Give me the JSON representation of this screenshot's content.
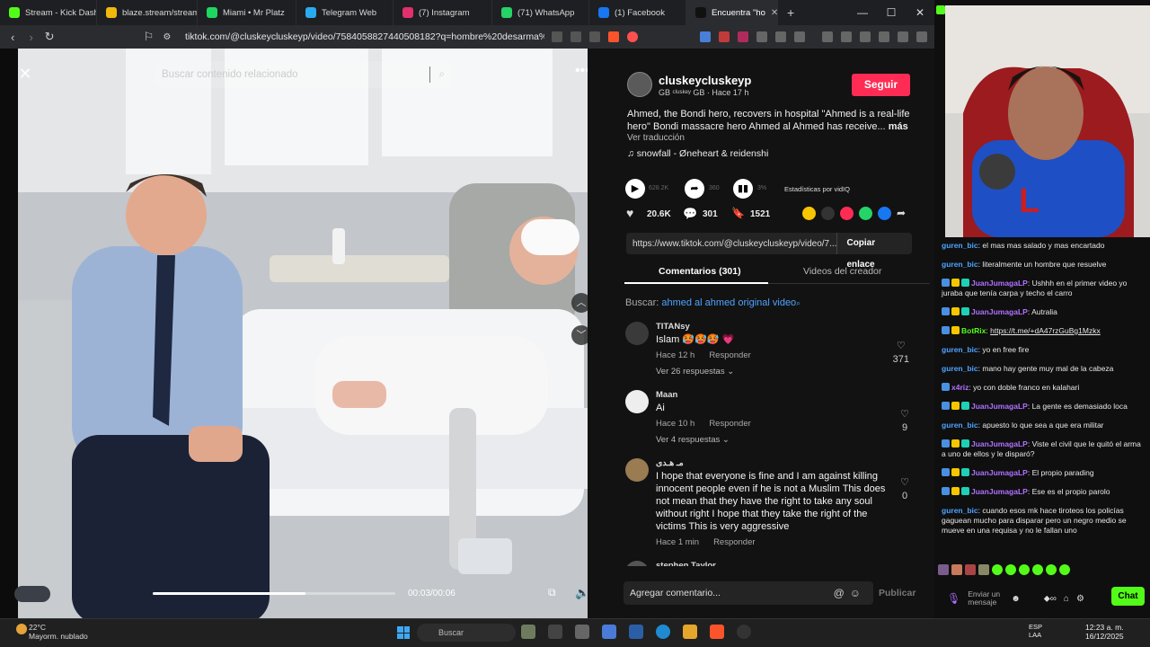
{
  "browser": {
    "tabs": [
      {
        "label": "Stream - Kick Dashbo",
        "color": "#53fc18",
        "active": false
      },
      {
        "label": "blaze.stream/stream-",
        "color": "#f0b90b",
        "active": false
      },
      {
        "label": "Miami • Mr Platz",
        "color": "#1ed760",
        "active": false
      },
      {
        "label": "Telegram Web",
        "color": "#2aabee",
        "active": false
      },
      {
        "label": "(7) Instagram",
        "color": "#e1306c",
        "active": false
      },
      {
        "label": "(71) WhatsApp",
        "color": "#25d366",
        "active": false
      },
      {
        "label": "(1) Facebook",
        "color": "#1877f2",
        "active": false
      },
      {
        "label": "Encuentra \"ho",
        "color": "#111111",
        "active": true
      }
    ],
    "url": "tiktok.com/@cluskeycluskeyp/video/7584058827440508182?q=hombre%20desarma%20tirad...",
    "new_tab": "+",
    "win_min": "—",
    "win_max": "☐",
    "win_close": "✕"
  },
  "video": {
    "search_placeholder": "Buscar contenido relacionado",
    "time": "00:03/00:06",
    "progress": 0.63
  },
  "post": {
    "username": "cluskeycluskeyp",
    "subline": "GB ᶜˡᵘˢᵏᵉʸ GB · Hace 17 h",
    "follow": "Seguir",
    "description": "Ahmed, the Bondi hero, recovers in hospital \"Ahmed is a real-life hero\" Bondi massacre hero Ahmed al Ahmed has receive...",
    "more": "más",
    "translate": "Ver traducción",
    "music": "snowfall - Øneheart & reidenshi",
    "stats_plays": "628.2K",
    "stats_shares": "360",
    "stats_pct": "3%",
    "stats_label": "Estadísticas por vidIQ",
    "likes": "20.6K",
    "comments": "301",
    "saves": "1521",
    "link": "https://www.tiktok.com/@cluskeycluskeyp/video/7...",
    "copy": "Copiar enlace",
    "tab_comments": "Comentarios (301)",
    "tab_videos": "Videos del creador",
    "search_prefix": "Buscar:",
    "search_term": "ahmed al ahmed original video"
  },
  "comments": [
    {
      "name": "TITANsy",
      "text": "Islam 🥵🥵🥵 💗",
      "time": "Hace 12 h",
      "reply": "Responder",
      "likes": "371",
      "more": "Ver 26 respuestas ⌄"
    },
    {
      "name": "Maan",
      "text": "Ai",
      "time": "Hace 10 h",
      "reply": "Responder",
      "likes": "9",
      "more": "Ver 4 respuestas ⌄"
    },
    {
      "name": "مـ هـدى",
      "text": "I hope that everyone is fine and I am against killing innocent people even if he is not a Muslim This does not mean that they have the right to take any soul without right I hope that they take the right of the victims This is very aggressive",
      "time": "Hace 1 min",
      "reply": "Responder",
      "likes": "0",
      "more": ""
    },
    {
      "name": "stephen Taylor",
      "text": "",
      "time": "",
      "reply": "",
      "likes": "",
      "more": ""
    }
  ],
  "composer": {
    "placeholder": "Agregar comentario...",
    "publish": "Publicar"
  },
  "chat": [
    {
      "user": "guren_bic",
      "color": "#4fa3ff",
      "text": "el mas mas salado y mas encartado",
      "badges": 0
    },
    {
      "user": "guren_bic",
      "color": "#4fa3ff",
      "text": "literalmente un hombre que resuelve",
      "badges": 0
    },
    {
      "user": "JuanJumagaLP",
      "color": "#b071ff",
      "text": "Ushhh en el primer video yo juraba que tenía carpa y techo el carro",
      "badges": 3
    },
    {
      "user": "JuanJumagaLP",
      "color": "#b071ff",
      "text": "Autralia",
      "badges": 3
    },
    {
      "user": "BotRix",
      "color": "#53fc18",
      "text": "https://t.me/+dA47rzGuBg1Mzkx",
      "badges": 2
    },
    {
      "user": "guren_bic",
      "color": "#4fa3ff",
      "text": "yo en free fire",
      "badges": 0
    },
    {
      "user": "guren_bic",
      "color": "#4fa3ff",
      "text": "mano hay gente muy mal de la cabeza",
      "badges": 0
    },
    {
      "user": "x4riz",
      "color": "#b071ff",
      "text": "yo con doble franco en kalahari",
      "badges": 1
    },
    {
      "user": "JuanJumagaLP",
      "color": "#b071ff",
      "text": "La gente es demasiado loca",
      "badges": 3
    },
    {
      "user": "guren_bic",
      "color": "#4fa3ff",
      "text": "apuesto lo que sea a que era militar",
      "badges": 0
    },
    {
      "user": "JuanJumagaLP",
      "color": "#b071ff",
      "text": "Viste el civil que le quitó el arma a uno de ellos y le disparó?",
      "badges": 3
    },
    {
      "user": "JuanJumagaLP",
      "color": "#b071ff",
      "text": "El propio parading",
      "badges": 3
    },
    {
      "user": "JuanJumagaLP",
      "color": "#b071ff",
      "text": "Ese es el propio parolo",
      "badges": 3
    },
    {
      "user": "guren_bic",
      "color": "#4fa3ff",
      "text": "cuando esos mk hace tiroteos los policías gaguean mucho para disparar pero un negro medio se mueve en una requisa y no le fallan uno",
      "badges": 0
    }
  ],
  "chatbar": {
    "placeholder": "Enviar un mensaje",
    "button": "Chat"
  },
  "taskbar": {
    "temp": "22°C",
    "weather": "Mayorm. nublado",
    "search": "Buscar",
    "lang1": "ESP",
    "lang2": "LAA",
    "time": "12:23 a. m.",
    "date": "16/12/2025"
  }
}
